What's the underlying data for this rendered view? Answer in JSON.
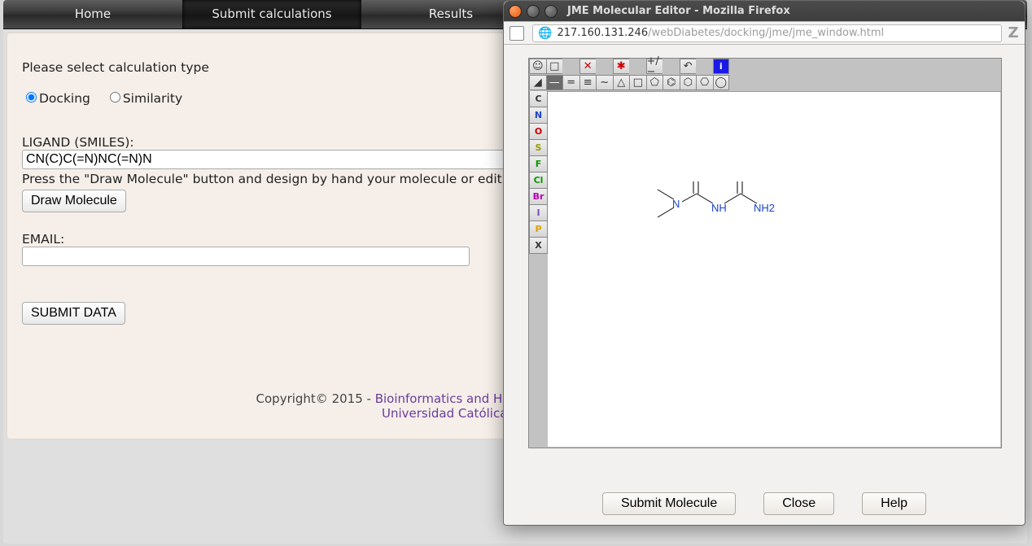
{
  "menu": {
    "home": "Home",
    "submit": "Submit calculations",
    "results": "Results"
  },
  "form": {
    "prompt": "Please select calculation type",
    "radio_docking": "Docking",
    "radio_similarity": "Similarity",
    "ligand_label": "LIGAND (SMILES):",
    "ligand_value": "CN(C)C(=N)NC(=N)N",
    "hint": "Press the \"Draw Molecule\" button and design by hand your molecule or edit reference molecule if desired",
    "draw_btn": "Draw Molecule",
    "email_label": "EMAIL:",
    "email_value": "",
    "submit_btn": "SUBMIT DATA"
  },
  "footer": {
    "copy": "Copyright© 2015 - ",
    "link1": "Bioinformatics and High Performance Computing Research Group",
    "line2_pre": "",
    "link2": "Universidad Católica San Antonio de Murcia"
  },
  "popup": {
    "title": "JME Molecular Editor - Mozilla Firefox",
    "url_host": "217.160.131.246",
    "url_path": "/webDiabetes/docking/jme/jme_window.html",
    "el": [
      "C",
      "N",
      "O",
      "S",
      "F",
      "Cl",
      "Br",
      "I",
      "P",
      "X"
    ],
    "buttons": {
      "submit": "Submit Molecule",
      "close": "Close",
      "help": "Help"
    },
    "molecule": {
      "labels": {
        "N1": "N",
        "NH": "NH",
        "NH2": "NH2"
      }
    }
  }
}
